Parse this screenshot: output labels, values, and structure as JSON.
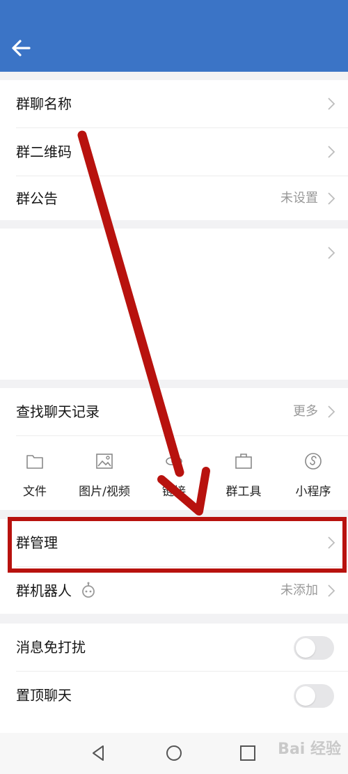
{
  "header": {
    "back_icon": "back-arrow-icon",
    "title": ""
  },
  "group_info": {
    "items": [
      {
        "label": "群聊名称",
        "value": ""
      },
      {
        "label": "群二维码",
        "value": ""
      },
      {
        "label": "群公告",
        "value": "未设置"
      }
    ]
  },
  "chat_history": {
    "label": "查找聊天记录",
    "more": "更多"
  },
  "tools": [
    {
      "label": "文件",
      "icon": "folder-icon"
    },
    {
      "label": "图片/视频",
      "icon": "image-icon"
    },
    {
      "label": "链接",
      "icon": "link-icon"
    },
    {
      "label": "群工具",
      "icon": "toolbox-icon"
    },
    {
      "label": "小程序",
      "icon": "mini-program-icon"
    }
  ],
  "management": {
    "group_manage": "群管理",
    "group_robot": "群机器人",
    "robot_value": "未添加"
  },
  "settings": {
    "mute_label": "消息免打扰",
    "mute_on": false,
    "pin_label": "置顶聊天",
    "pin_on": false
  },
  "watermark": "Bai 经验",
  "colors": {
    "header": "#3b74c6",
    "annotation": "#b8120e"
  }
}
